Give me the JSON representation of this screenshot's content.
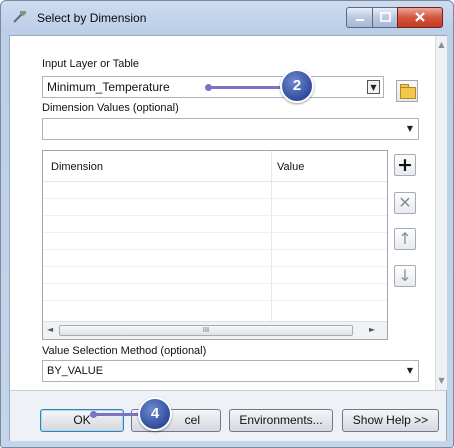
{
  "window": {
    "title": "Select by Dimension"
  },
  "form": {
    "input_layer_label": "Input Layer or Table",
    "input_layer_value": "Minimum_Temperature",
    "dimension_values_label": "Dimension Values (optional)",
    "dimension_values_value": "",
    "table": {
      "columns": [
        "Dimension",
        "Value"
      ],
      "rows": []
    },
    "selection_method_label": "Value Selection Method (optional)",
    "selection_method_value": "BY_VALUE"
  },
  "side_buttons": {
    "add": "+",
    "remove": "✕",
    "up": "↑",
    "down": "↓"
  },
  "scrollbar_thumb_grip": "III",
  "buttons": {
    "ok": "OK",
    "cancel_partial": "cel",
    "environments": "Environments...",
    "show_help": "Show Help >>"
  },
  "callouts": {
    "input_layer_step": "2",
    "ok_step": "4"
  },
  "colors": {
    "callout_fill": "#304c9e",
    "callout_pointer": "#7b73c4",
    "close_button": "#c43a23"
  }
}
